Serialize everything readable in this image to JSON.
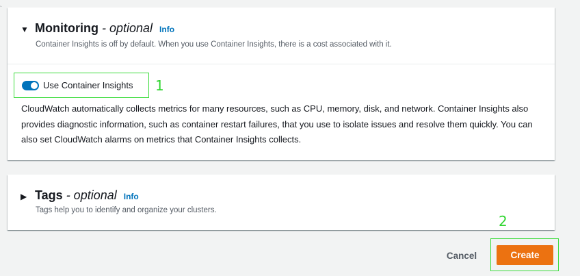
{
  "monitoring": {
    "title": "Monitoring",
    "optional": "- optional",
    "info": "Info",
    "description": "Container Insights is off by default. When you use Container Insights, there is a cost associated with it.",
    "toggle_label": "Use Container Insights",
    "toggle_on": true,
    "body": "CloudWatch automatically collects metrics for many resources, such as CPU, memory, disk, and network. Container Insights also provides diagnostic information, such as container restart failures, that you use to isolate issues and resolve them quickly. You can also set CloudWatch alarms on metrics that Container Insights collects."
  },
  "tags": {
    "title": "Tags",
    "optional": "- optional",
    "info": "Info",
    "description": "Tags help you to identify and organize your clusters."
  },
  "annotations": {
    "first": "1",
    "second": "2"
  },
  "actions": {
    "cancel": "Cancel",
    "create": "Create"
  },
  "colors": {
    "accent": "#0073bb",
    "primary_button": "#ec7211",
    "annotation": "#2fd52f",
    "background": "#f2f3f3"
  },
  "icons": {
    "expanded": "caret-down-icon",
    "collapsed": "caret-right-icon"
  }
}
